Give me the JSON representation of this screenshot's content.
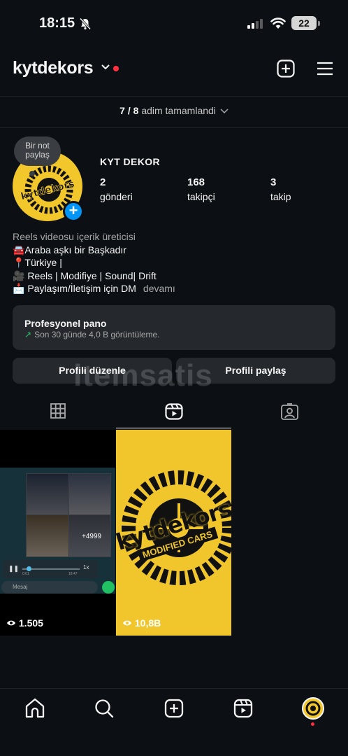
{
  "status_bar": {
    "time": "18:15",
    "battery": "22"
  },
  "header": {
    "username": "kytdekors"
  },
  "progress": {
    "count": "7 / 8",
    "label": "adim tamamlandi"
  },
  "note": {
    "line1": "Bir not",
    "line2": "paylaş"
  },
  "profile": {
    "display_name": "KYT DEKOR",
    "avatar_text": "kytdekors",
    "stats": [
      {
        "num": "2",
        "label": "gönderi"
      },
      {
        "num": "168",
        "label": "takipçi"
      },
      {
        "num": "3",
        "label": "takip"
      }
    ],
    "bio": {
      "category": "Reels videosu içerik üreticisi",
      "lines": [
        "🚘Araba aşkı bir Başkadır",
        "📍Türkiye |",
        "🎥 Reels | Modifiye | Sound| Drift",
        "📩 Paylaşım/İletişim için DM"
      ],
      "more": "devamı"
    }
  },
  "dashboard": {
    "title": "Profesyonel pano",
    "subtitle": "Son 30 günde 4,0 B görüntüleme."
  },
  "buttons": {
    "edit": "Profili düzenle",
    "share": "Profili paylaş"
  },
  "watermark": "itemsatis",
  "tabs": [
    "grid",
    "reels",
    "tagged"
  ],
  "posts": [
    {
      "views": "1.505",
      "overlay_count": "+4999",
      "chat_placeholder": "Mesaj",
      "audio_speed": "1x",
      "time_start": "0:01",
      "time_end": "18:47"
    },
    {
      "views": "10,8B",
      "brand": "kytdekors",
      "tagline": "MODIFIED CARS"
    }
  ],
  "colors": {
    "background": "#0c1014",
    "accent": "#0095f6",
    "brand_yellow": "#f1c62c",
    "notification": "#ff3040"
  }
}
